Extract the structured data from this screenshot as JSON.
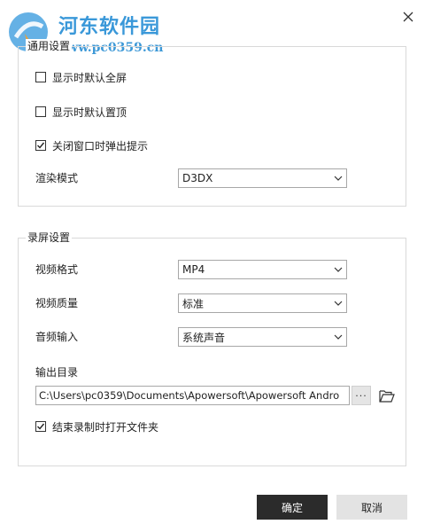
{
  "watermark": {
    "title": "河东软件园",
    "url": "www.pc0359.cn"
  },
  "general": {
    "title": "通用设置",
    "fullscreen_label": "显示时默认全屏",
    "fullscreen_checked": false,
    "ontop_label": "显示时默认置顶",
    "ontop_checked": false,
    "popup_label": "关闭窗口时弹出提示",
    "popup_checked": true,
    "render_label": "渲染模式",
    "render_value": "D3DX"
  },
  "record": {
    "title": "录屏设置",
    "format_label": "视频格式",
    "format_value": "MP4",
    "quality_label": "视频质量",
    "quality_value": "标准",
    "audio_label": "音频输入",
    "audio_value": "系统声音",
    "output_label": "输出目录",
    "output_path": "C:\\Users\\pc0359\\Documents\\Apowersoft\\Apowersoft Andro",
    "browse_label": "···",
    "open_folder_label": "结束录制时打开文件夹",
    "open_folder_checked": true
  },
  "buttons": {
    "ok": "确定",
    "cancel": "取消"
  },
  "icons": {
    "close": "close-icon",
    "chevron": "chevron-down-icon",
    "check": "checkmark-icon",
    "folder": "folder-open-icon"
  }
}
